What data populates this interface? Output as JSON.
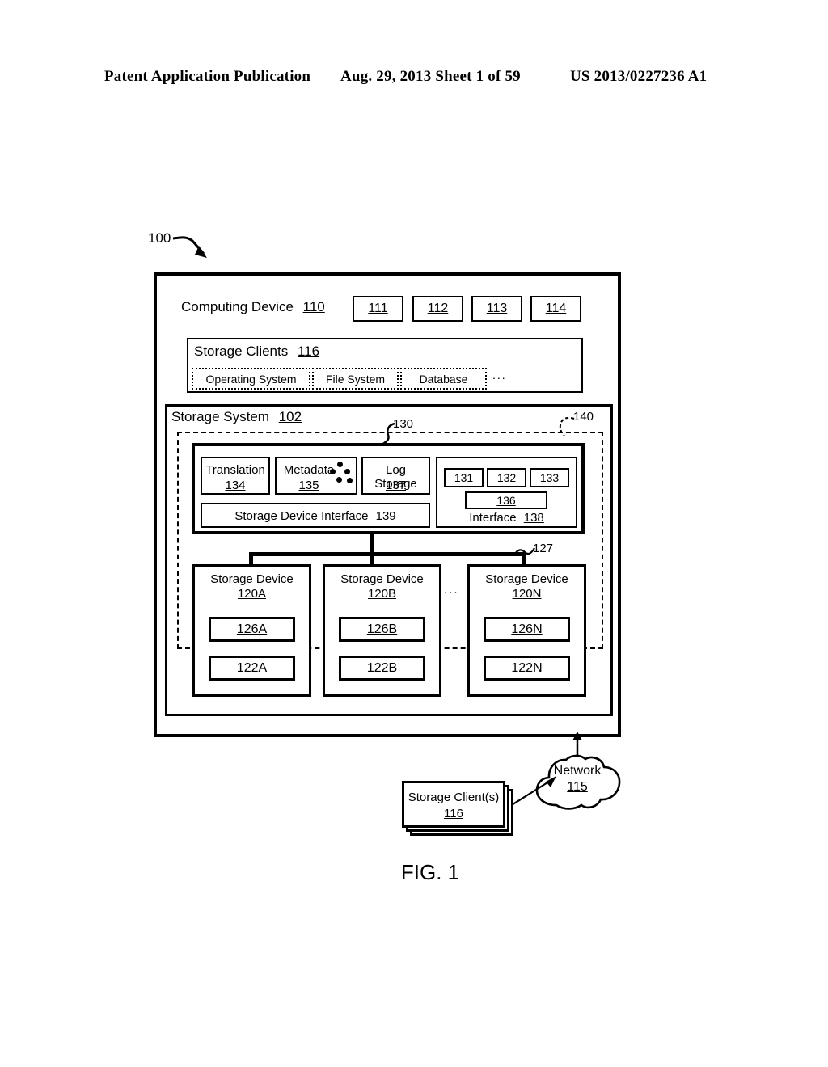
{
  "header": {
    "left": "Patent Application Publication",
    "middle": "Aug. 29, 2013  Sheet 1 of 59",
    "right": "US 2013/0227236 A1"
  },
  "figure": {
    "caption": "FIG. 1",
    "system_ref": "100",
    "refs": {
      "modules_group": "130",
      "dashed_region": "140",
      "bus_127": "127"
    },
    "computing_device": {
      "label": "Computing Device",
      "ref": "110",
      "components": [
        "111",
        "112",
        "113",
        "114"
      ]
    },
    "storage_clients": {
      "label": "Storage Clients",
      "ref": "116",
      "items": [
        "Operating System",
        "File System",
        "Database"
      ],
      "ellipsis": "..."
    },
    "storage_system": {
      "label": "Storage System",
      "ref": "102",
      "modules": {
        "translation": {
          "label": "Translation",
          "ref": "134"
        },
        "metadata": {
          "label": "Metadata",
          "ref": "135",
          "icon": "node-graph-icon"
        },
        "log_storage": {
          "label": "Log Storage",
          "ref": "137"
        },
        "storage_device_interface": {
          "label": "Storage Device Interface",
          "ref": "139"
        },
        "interface": {
          "label": "Interface",
          "ref": "138",
          "sub_refs": [
            "131",
            "132",
            "133"
          ],
          "wide_ref": "136"
        }
      },
      "storage_devices": [
        {
          "label": "Storage Device",
          "ref": "120A",
          "upper_ref": "126A",
          "lower_ref": "122A"
        },
        {
          "label": "Storage Device",
          "ref": "120B",
          "upper_ref": "126B",
          "lower_ref": "122B"
        },
        {
          "label": "Storage Device",
          "ref": "120N",
          "upper_ref": "126N",
          "lower_ref": "122N"
        }
      ],
      "devices_ellipsis": "..."
    },
    "network": {
      "label": "Network",
      "ref": "115"
    },
    "remote_clients": {
      "label": "Storage Client(s)",
      "ref": "116"
    }
  }
}
